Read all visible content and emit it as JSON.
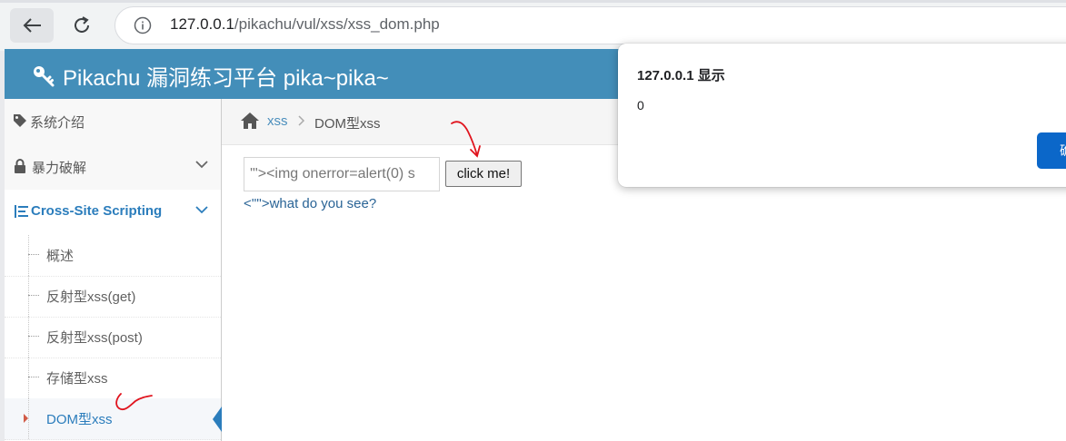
{
  "browser": {
    "url_host": "127.0.0.1",
    "url_path": "/pikachu/vul/xss/xss_dom.php"
  },
  "header": {
    "title": "Pikachu 漏洞练习平台 pika~pika~"
  },
  "sidebar": {
    "items": [
      {
        "label": "系统介绍",
        "icon": "tags-icon"
      },
      {
        "label": "暴力破解",
        "icon": "lock-icon"
      },
      {
        "label": "Cross-Site Scripting",
        "icon": "list-icon"
      }
    ],
    "subitems": [
      {
        "label": "概述"
      },
      {
        "label": "反射型xss(get)"
      },
      {
        "label": "反射型xss(post)"
      },
      {
        "label": "存储型xss"
      },
      {
        "label": "DOM型xss"
      }
    ]
  },
  "breadcrumbs": {
    "items": [
      "xss",
      "DOM型xss"
    ]
  },
  "form": {
    "input_value": "'\"><img onerror=alert(0) s",
    "button_label": "click me!",
    "link_text": "<'\"'>what do you see?"
  },
  "alert": {
    "title": "127.0.0.1 显示",
    "message": "0",
    "ok_label": "确定"
  },
  "colors": {
    "header": "#438eb9",
    "accent": "#2b7dbc",
    "dialog_button": "#0b67c9",
    "annotation": "#e0141e"
  }
}
